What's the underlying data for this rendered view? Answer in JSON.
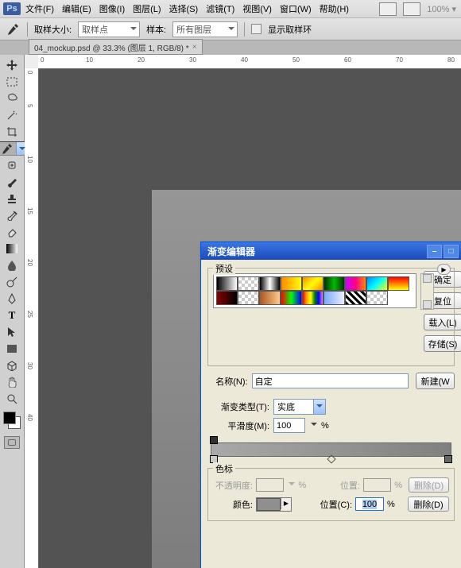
{
  "menu": {
    "file": "文件(F)",
    "edit": "编辑(E)",
    "image": "图像(I)",
    "layer": "图层(L)",
    "select": "选择(S)",
    "filter": "滤镜(T)",
    "view": "视图(V)",
    "window": "窗口(W)",
    "help": "帮助(H)",
    "zoom": "100% ▾"
  },
  "opt": {
    "sample_size_lbl": "取样大小:",
    "sample_size_val": "取样点",
    "sample_lbl": "样本:",
    "sample_val": "所有图层",
    "ring_lbl": "显示取样环"
  },
  "doc": {
    "tab": "04_mockup.psd @ 33.3% (图层 1, RGB/8) *"
  },
  "ruler": {
    "h": [
      "0",
      "10",
      "20",
      "30",
      "40",
      "50",
      "60",
      "70",
      "80"
    ],
    "v": [
      "0",
      "5",
      "10",
      "15",
      "20",
      "25",
      "30",
      "40"
    ]
  },
  "dlg": {
    "title": "渐变编辑器",
    "presets_lbl": "预设",
    "btn_ok": "确定",
    "btn_reset": "复位",
    "btn_load": "载入(L)",
    "btn_save": "存储(S)",
    "btn_new": "新建(W",
    "name_lbl": "名称(N):",
    "name_val": "自定",
    "type_lbl": "渐变类型(T):",
    "type_val": "实底",
    "smooth_lbl": "平滑度(M):",
    "smooth_val": "100",
    "pct": "%",
    "stops_lbl": "色标",
    "opacity_lbl": "不透明度:",
    "loc_lbl": "位置:",
    "loc2_lbl": "位置(C):",
    "loc_val": "100",
    "color_lbl": "颜色:",
    "btn_del": "删除(D)"
  }
}
